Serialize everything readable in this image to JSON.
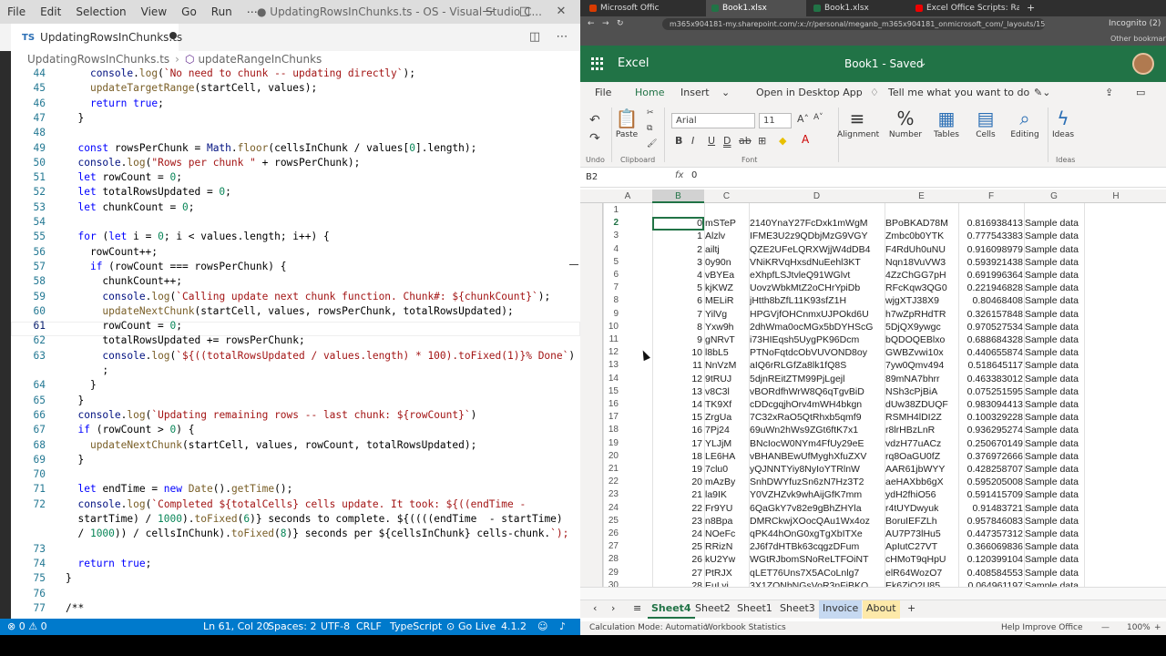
{
  "vscode": {
    "menu": [
      "File",
      "Edit",
      "Selection",
      "View",
      "Go",
      "Run",
      "⋯"
    ],
    "title": "● UpdatingRowsInChunks.ts - OS - Visual Studio C...",
    "tab": "UpdatingRowsInChunks.ts",
    "tab_badge": "TS",
    "breadcrumb": [
      "UpdatingRowsInChunks.ts",
      "updateRangeInChunks"
    ],
    "status": {
      "errors": "⊗ 0 ⚠ 0",
      "position": "Ln 61, Col 20",
      "spaces": "Spaces: 2",
      "encoding": "UTF-8",
      "eol": "CRLF",
      "language": "TypeScript",
      "golive": "Go Live",
      "version": "4.1.2"
    },
    "lines": [
      {
        "n": "44",
        "t": "    console.log(`No need to chunk -- updating directly`);"
      },
      {
        "n": "45",
        "t": "    updateTargetRange(startCell, values);"
      },
      {
        "n": "46",
        "t": "    return true;"
      },
      {
        "n": "47",
        "t": "  }"
      },
      {
        "n": "48",
        "t": ""
      },
      {
        "n": "49",
        "t": "  const rowsPerChunk = Math.floor(cellsInChunk / values[0].length);"
      },
      {
        "n": "50",
        "t": "  console.log(\"Rows per chunk \" + rowsPerChunk);"
      },
      {
        "n": "51",
        "t": "  let rowCount = 0;"
      },
      {
        "n": "52",
        "t": "  let totalRowsUpdated = 0;"
      },
      {
        "n": "53",
        "t": "  let chunkCount = 0;"
      },
      {
        "n": "54",
        "t": ""
      },
      {
        "n": "55",
        "t": "  for (let i = 0; i < values.length; i++) {"
      },
      {
        "n": "56",
        "t": "    rowCount++;"
      },
      {
        "n": "57",
        "t": "    if (rowCount === rowsPerChunk) {"
      },
      {
        "n": "58",
        "t": "      chunkCount++;"
      },
      {
        "n": "59",
        "t": "      console.log(`Calling update next chunk function. Chunk#: ${chunkCount}`);"
      },
      {
        "n": "60",
        "t": "      updateNextChunk(startCell, values, rowsPerChunk, totalRowsUpdated);"
      },
      {
        "n": "61",
        "t": "      rowCount = 0;"
      },
      {
        "n": "62",
        "t": "      totalRowsUpdated += rowsPerChunk;"
      },
      {
        "n": "63",
        "t": "      console.log(`${((totalRowsUpdated / values.length) * 100).toFixed(1)}% Done`)"
      },
      {
        "n": "",
        "t": "      ;"
      },
      {
        "n": "64",
        "t": "    }"
      },
      {
        "n": "65",
        "t": "  }"
      },
      {
        "n": "66",
        "t": "  console.log(`Updating remaining rows -- last chunk: ${rowCount}`)"
      },
      {
        "n": "67",
        "t": "  if (rowCount > 0) {"
      },
      {
        "n": "68",
        "t": "    updateNextChunk(startCell, values, rowCount, totalRowsUpdated);"
      },
      {
        "n": "69",
        "t": "  }"
      },
      {
        "n": "70",
        "t": ""
      },
      {
        "n": "71",
        "t": "  let endTime = new Date().getTime();"
      },
      {
        "n": "72",
        "t": "  console.log(`Completed ${totalCells} cells update. It took: ${((endTime -"
      },
      {
        "n": "",
        "t": "  startTime) / 1000).toFixed(6)} seconds to complete. ${((((endTime  - startTime)"
      },
      {
        "n": "",
        "t": "  / 1000)) / cellsInChunk).toFixed(8)} seconds per ${cellsInChunk} cells-chunk.`);"
      },
      {
        "n": "73",
        "t": ""
      },
      {
        "n": "74",
        "t": "  return true;"
      },
      {
        "n": "75",
        "t": "}"
      },
      {
        "n": "76",
        "t": ""
      },
      {
        "n": "77",
        "t": "/**"
      }
    ]
  },
  "browser": {
    "tabs": [
      "Microsoft Office Home",
      "Book1.xlsx",
      "Book1.xlsx",
      "Excel Office Scripts: Range read"
    ],
    "url": "m365x904181-my.sharepoint.com/:x:/r/personal/meganb_m365x904181_onmicrosoft_com/_layouts/15/Doc.aspx?sourcedoc=%7B...",
    "profile": "Incognito (2)",
    "bookmarks": "Other bookmarks"
  },
  "excel": {
    "app": "Excel",
    "doc": "Book1 - Saved",
    "menu": [
      "File",
      "Home",
      "Insert",
      "Open in Desktop App",
      "Tell me what you want to do"
    ],
    "ribbon": {
      "paste": "Paste",
      "undo": "Undo",
      "clipboard": "Clipboard",
      "font_group": "Font",
      "font": "Arial",
      "size": "11",
      "alignment": "Alignment",
      "number": "Number",
      "tables": "Tables",
      "cells": "Cells",
      "editing": "Editing",
      "ideas": "Ideas",
      "ideas_group": "Ideas"
    },
    "namebox": "B2",
    "fx": "fx",
    "formula": "0",
    "columns": [
      "A",
      "B",
      "C",
      "D",
      "E",
      "F",
      "G",
      "H"
    ],
    "rows": [
      {
        "r": "1",
        "b": "",
        "c": "",
        "d": "",
        "e": "",
        "f": "",
        "g": ""
      },
      {
        "r": "2",
        "b": "0",
        "c": "mSTeP",
        "d": "2140YnaY27FcDxk1mWgM",
        "e": "BPoBKAD78M",
        "f": "0.816938413",
        "g": "Sample data"
      },
      {
        "r": "3",
        "b": "1",
        "c": "Alzlv",
        "d": "IFME3U2z9QDbjMzG9VGY",
        "e": "Zmbc0b0YTK",
        "f": "0.777543383",
        "g": "Sample data"
      },
      {
        "r": "4",
        "b": "2",
        "c": "ailtj",
        "d": "QZE2UFeLQRXWjjW4dDB4",
        "e": "F4RdUh0uNU",
        "f": "0.916098979",
        "g": "Sample data"
      },
      {
        "r": "5",
        "b": "3",
        "c": "0y90n",
        "d": "VNiKRVqHxsdNuEehl3KT",
        "e": "Nqn18VuVW3",
        "f": "0.593921438",
        "g": "Sample data"
      },
      {
        "r": "6",
        "b": "4",
        "c": "vBYEa",
        "d": "eXhpfLSJtvleQ91WGlvt",
        "e": "4ZzChGG7pH",
        "f": "0.691996364",
        "g": "Sample data"
      },
      {
        "r": "7",
        "b": "5",
        "c": "kjKWZ",
        "d": "UovzWbkMtZ2oCHrYpiDb",
        "e": "RFcKqw3QG0",
        "f": "0.221946828",
        "g": "Sample data"
      },
      {
        "r": "8",
        "b": "6",
        "c": "MELiR",
        "d": "jHtth8bZfL11K93sfZ1H",
        "e": "wjgXTJ38X9",
        "f": "0.80468408",
        "g": "Sample data"
      },
      {
        "r": "9",
        "b": "7",
        "c": "YilVg",
        "d": "HPGVjfOHCnmxUJPOkd6U",
        "e": "h7wZpRHdTR",
        "f": "0.326157848",
        "g": "Sample data"
      },
      {
        "r": "10",
        "b": "8",
        "c": "Yxw9h",
        "d": "2dhWma0ocMGx5bDYHScG",
        "e": "5DjQX9ywgc",
        "f": "0.970527534",
        "g": "Sample data"
      },
      {
        "r": "11",
        "b": "9",
        "c": "gNRvT",
        "d": "i73HIEqsh5UygPK96Dcm",
        "e": "bQDOQEBlxo",
        "f": "0.688684328",
        "g": "Sample data"
      },
      {
        "r": "12",
        "b": "10",
        "c": "l8bL5",
        "d": "PTNoFqtdcObVUVOND8oy",
        "e": "GWBZvwi10x",
        "f": "0.440655874",
        "g": "Sample data"
      },
      {
        "r": "13",
        "b": "11",
        "c": "NnVzM",
        "d": "aIQ6rRLGfZa8lk1fQ8S",
        "e": "7yw0Qmv494",
        "f": "0.518645117",
        "g": "Sample data"
      },
      {
        "r": "14",
        "b": "12",
        "c": "9tRUJ",
        "d": "5djnREitZTM99PjLgejl",
        "e": "89mNA7bhrr",
        "f": "0.463383012",
        "g": "Sample data"
      },
      {
        "r": "15",
        "b": "13",
        "c": "v8C3l",
        "d": "vBORdfhWrW8Q6qTgvBiD",
        "e": "NSh3cPjBiA",
        "f": "0.075251595",
        "g": "Sample data"
      },
      {
        "r": "16",
        "b": "14",
        "c": "TK9Xf",
        "d": "cDDcgqjhOrv4mWH4bkgn",
        "e": "dUw38ZDUQF",
        "f": "0.983094413",
        "g": "Sample data"
      },
      {
        "r": "17",
        "b": "15",
        "c": "ZrgUa",
        "d": "7C32xRaO5QtRhxb5qmf9",
        "e": "RSMH4lDI2Z",
        "f": "0.100329228",
        "g": "Sample data"
      },
      {
        "r": "18",
        "b": "16",
        "c": "7Pj24",
        "d": "69uWn2hWs9ZGt6ftK7x1",
        "e": "r8lrHBzLnR",
        "f": "0.936295274",
        "g": "Sample data"
      },
      {
        "r": "19",
        "b": "17",
        "c": "YLJjM",
        "d": "BNcIocW0NYm4FfUy29eE",
        "e": "vdzH77uACz",
        "f": "0.250670149",
        "g": "Sample data"
      },
      {
        "r": "20",
        "b": "18",
        "c": "LE6HA",
        "d": "vBHANBEwUfMyghXfuZXV",
        "e": "rq8OaGU0fZ",
        "f": "0.376972666",
        "g": "Sample data"
      },
      {
        "r": "21",
        "b": "19",
        "c": "7clu0",
        "d": "yQJNNTYiy8NyIoYTRlnW",
        "e": "AAR61jbWYY",
        "f": "0.428258707",
        "g": "Sample data"
      },
      {
        "r": "22",
        "b": "20",
        "c": "mAzBy",
        "d": "SnhDWYfuzSn6zN7Hz3T2",
        "e": "aeHAXbb6gX",
        "f": "0.595205008",
        "g": "Sample data"
      },
      {
        "r": "23",
        "b": "21",
        "c": "la9IK",
        "d": "Y0VZHZvk9whAijGfK7mm",
        "e": "ydH2fhiO56",
        "f": "0.591415709",
        "g": "Sample data"
      },
      {
        "r": "24",
        "b": "22",
        "c": "Fr9YU",
        "d": "6QaGkY7v82e9gBhZHYla",
        "e": "r4tUYDwyuk",
        "f": "0.91483721",
        "g": "Sample data"
      },
      {
        "r": "25",
        "b": "23",
        "c": "n8Bpa",
        "d": "DMRCkwjXOocQAu1Wx4oz",
        "e": "BoruIEFZLh",
        "f": "0.957846083",
        "g": "Sample data"
      },
      {
        "r": "26",
        "b": "24",
        "c": "NOeFc",
        "d": "qPK44hOnG0xgTgXbITXe",
        "e": "AU7P73lHu5",
        "f": "0.447357312",
        "g": "Sample data"
      },
      {
        "r": "27",
        "b": "25",
        "c": "RRizN",
        "d": "2J6f7dHTBk63cqgzDFum",
        "e": "ApIutC27VT",
        "f": "0.366069836",
        "g": "Sample data"
      },
      {
        "r": "28",
        "b": "26",
        "c": "kU2Yw",
        "d": "WGtRJbomSNoReLTFOiNT",
        "e": "cHMoT9qHpU",
        "f": "0.120399104",
        "g": "Sample data"
      },
      {
        "r": "29",
        "b": "27",
        "c": "PtRJX",
        "d": "qLET76Uns7X5ACoLnlg7",
        "e": "elR64WozO7",
        "f": "0.408584553",
        "g": "Sample data"
      },
      {
        "r": "30",
        "b": "28",
        "c": "EuLyi",
        "d": "3X1ZONbNGsVoR3nFjBKQ",
        "e": "Ek6ZiQ2U85",
        "f": "0.064961197",
        "g": "Sample data"
      }
    ],
    "sheets": [
      "Sheet4",
      "Sheet2",
      "Sheet1",
      "Sheet3",
      "Invoice",
      "About"
    ],
    "status": {
      "calc": "Calculation Mode: Automatic",
      "stats": "Workbook Statistics",
      "help": "Help Improve Office",
      "zoom": "100%"
    }
  }
}
